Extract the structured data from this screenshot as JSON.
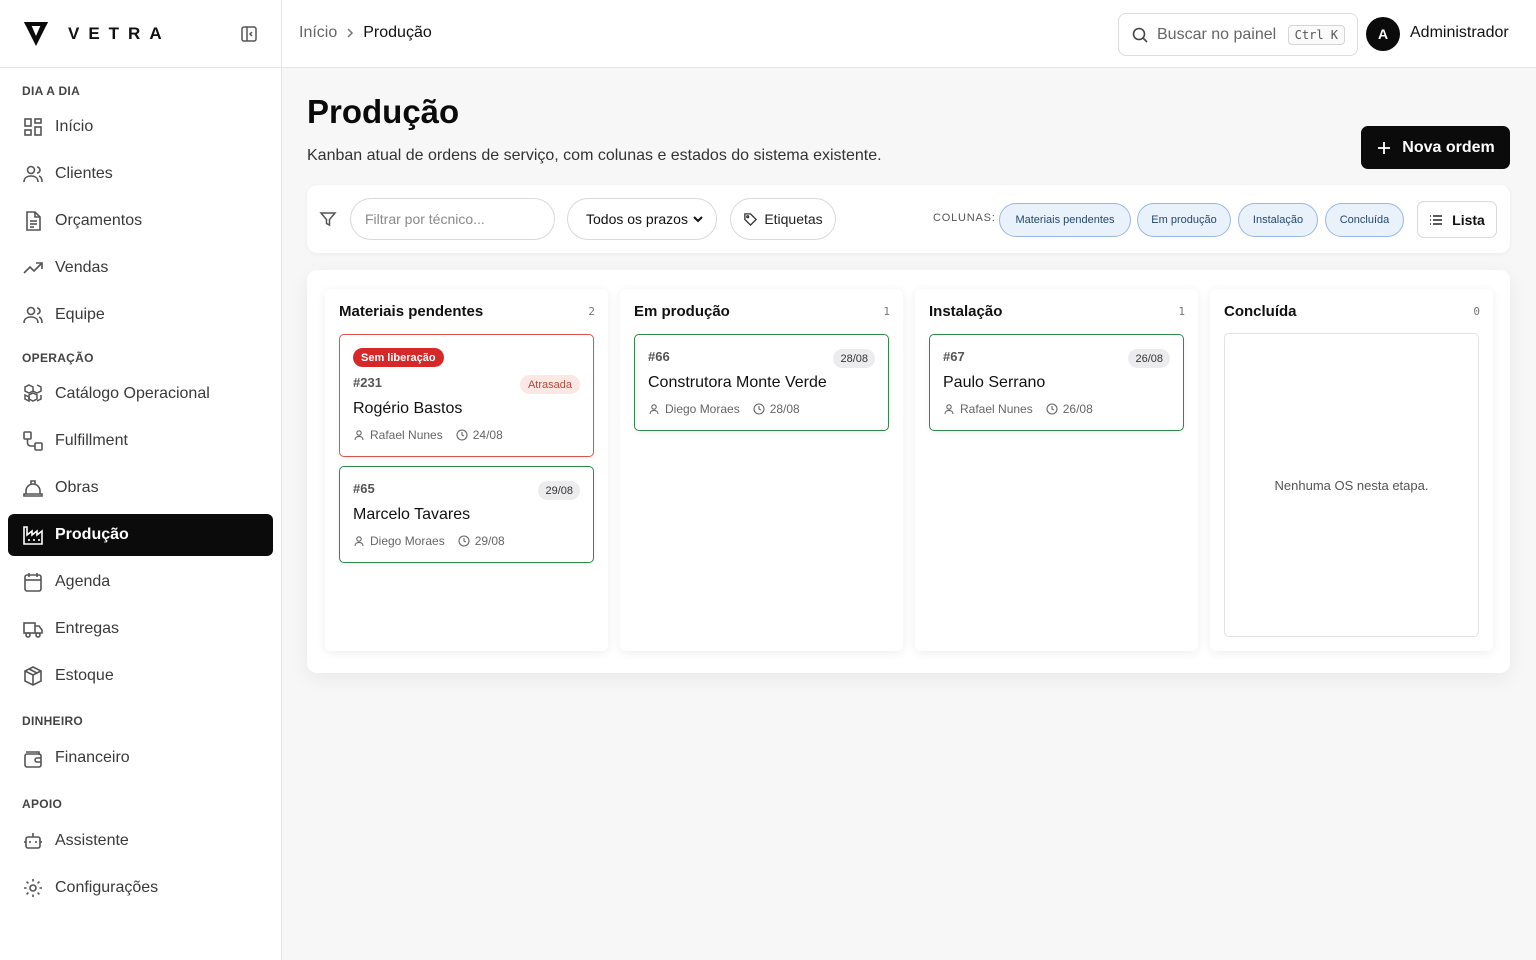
{
  "brand": {
    "name": "VETRA"
  },
  "sidebar": {
    "groups": [
      {
        "title": "DIA A DIA",
        "items": [
          {
            "label": "Início",
            "icon": "layout-grid-icon"
          },
          {
            "label": "Clientes",
            "icon": "users-icon"
          },
          {
            "label": "Orçamentos",
            "icon": "file-text-icon"
          },
          {
            "label": "Vendas",
            "icon": "trending-up-icon"
          },
          {
            "label": "Equipe",
            "icon": "users-icon"
          }
        ]
      },
      {
        "title": "OPERAÇÃO",
        "items": [
          {
            "label": "Catálogo Operacional",
            "icon": "boxes-icon"
          },
          {
            "label": "Fulfillment",
            "icon": "workflow-icon"
          },
          {
            "label": "Obras",
            "icon": "hard-hat-icon"
          },
          {
            "label": "Produção",
            "icon": "factory-icon",
            "active": true
          },
          {
            "label": "Agenda",
            "icon": "calendar-icon"
          },
          {
            "label": "Entregas",
            "icon": "truck-icon"
          },
          {
            "label": "Estoque",
            "icon": "package-icon"
          }
        ]
      },
      {
        "title": "DINHEIRO",
        "items": [
          {
            "label": "Financeiro",
            "icon": "wallet-icon"
          }
        ]
      },
      {
        "title": "APOIO",
        "items": [
          {
            "label": "Assistente",
            "icon": "bot-icon"
          },
          {
            "label": "Configurações",
            "icon": "settings-icon"
          }
        ]
      }
    ]
  },
  "topbar": {
    "breadcrumb": {
      "home": "Início",
      "current": "Produção"
    },
    "search": {
      "placeholder": "Buscar no painel",
      "shortcut": "Ctrl K"
    },
    "user": {
      "initial": "A",
      "name": "Administrador"
    }
  },
  "page": {
    "title": "Produção",
    "subtitle": "Kanban atual de ordens de serviço, com colunas e estados do sistema existente.",
    "new_button": "Nova ordem"
  },
  "filters": {
    "technician_placeholder": "Filtrar por técnico...",
    "deadline_selected": "Todos os prazos",
    "tags_label": "Etiquetas",
    "columns_label": "COLUNAS:",
    "column_chips": [
      "Materiais pendentes",
      "Em produção",
      "Instalação",
      "Concluída"
    ],
    "view_label": "Lista"
  },
  "board": {
    "columns": [
      {
        "title": "Materiais pendentes",
        "count": "2",
        "cards": [
          {
            "id": "#231",
            "client": "Rogério Bastos",
            "technician": "Rafael Nunes",
            "date": "24/08",
            "badge": "Sem liberação",
            "status": "Atrasada"
          },
          {
            "id": "#65",
            "client": "Marcelo Tavares",
            "technician": "Diego Moraes",
            "date": "29/08",
            "pill": "29/08"
          }
        ]
      },
      {
        "title": "Em produção",
        "count": "1",
        "cards": [
          {
            "id": "#66",
            "client": "Construtora Monte Verde",
            "technician": "Diego Moraes",
            "date": "28/08",
            "pill": "28/08"
          }
        ]
      },
      {
        "title": "Instalação",
        "count": "1",
        "cards": [
          {
            "id": "#67",
            "client": "Paulo Serrano",
            "technician": "Rafael Nunes",
            "date": "26/08",
            "pill": "26/08"
          }
        ]
      },
      {
        "title": "Concluída",
        "count": "0",
        "cards": [],
        "empty_text": "Nenhuma OS nesta etapa."
      }
    ]
  },
  "colors": {
    "accent": "#0b0b0c",
    "card_border_ok": "#2f8a4a",
    "card_border_late": "#d9534f",
    "badge_red": "#d62828",
    "chip_bg": "#e9f1fb"
  }
}
